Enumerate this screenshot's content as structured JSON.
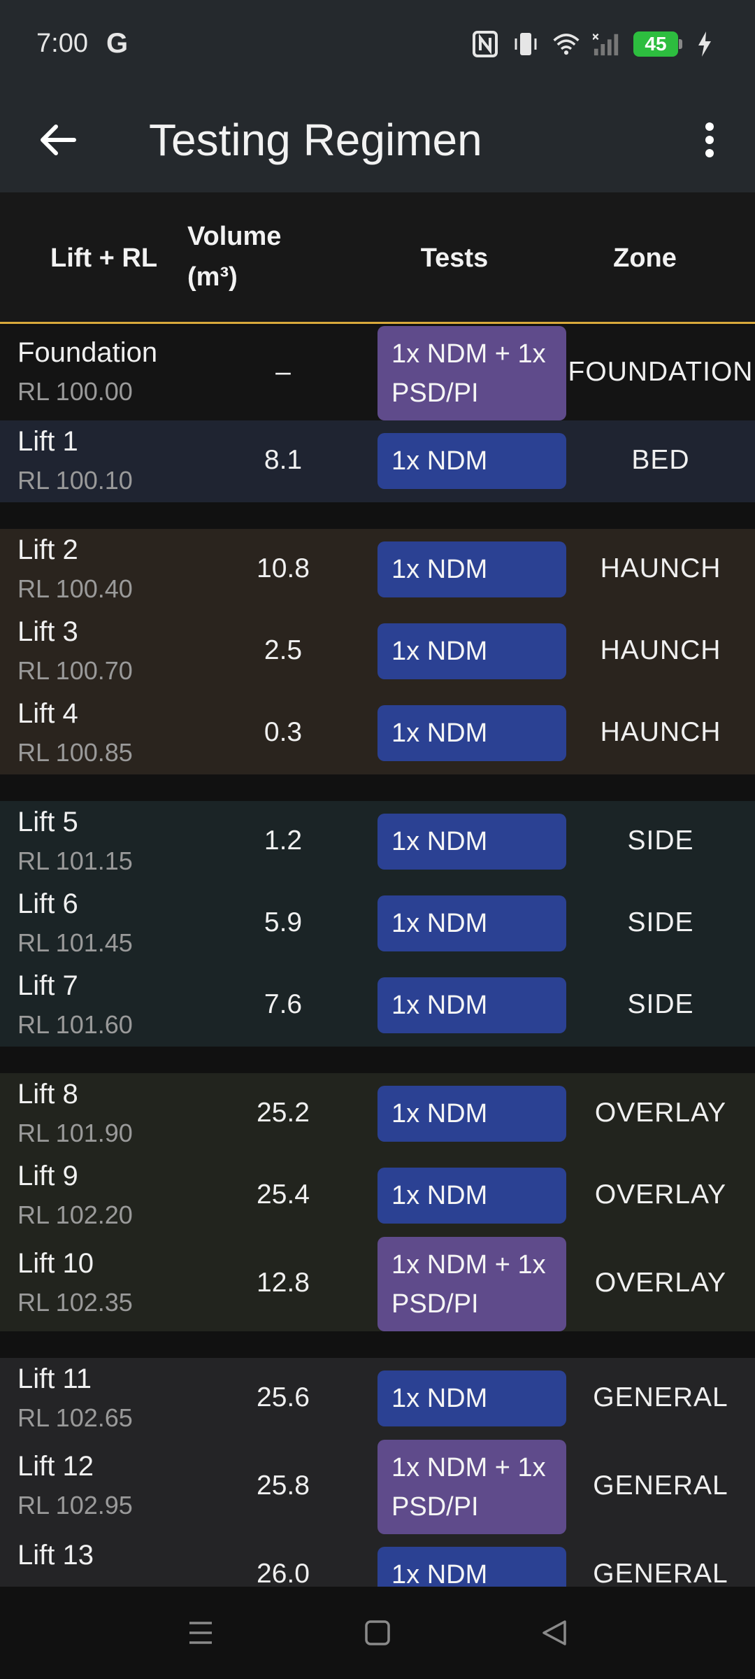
{
  "status_bar": {
    "time": "7:00",
    "g_label": "G",
    "battery": "45",
    "icons": [
      "nfc-icon",
      "vibrate-icon",
      "wifi-icon",
      "signal-icon",
      "charging-icon"
    ]
  },
  "app_bar": {
    "title": "Testing Regimen",
    "back_icon": "arrow-back-icon",
    "menu_icon": "more-vert-icon"
  },
  "table": {
    "headers": {
      "lift": "Lift + RL",
      "volume_line1": "Volume",
      "volume_line2": "(m³)",
      "tests": "Tests",
      "zone": "Zone"
    },
    "accent_color": "#d9a93b",
    "groups": [
      {
        "color": "#141414",
        "rows": [
          {
            "name": "Foundation",
            "rl": "RL 100.00",
            "volume": "–",
            "test": "1x NDM + 1x PSD/PI",
            "test_type": "psd",
            "zone": "FOUNDATION"
          }
        ]
      },
      {
        "color": "#1f2431",
        "rows": [
          {
            "name": "Lift 1",
            "rl": "RL 100.10",
            "volume": "8.1",
            "test": "1x NDM",
            "test_type": "ndm",
            "zone": "BED"
          }
        ]
      },
      {
        "color": "#2a241e",
        "rows": [
          {
            "name": "Lift 2",
            "rl": "RL 100.40",
            "volume": "10.8",
            "test": "1x NDM",
            "test_type": "ndm",
            "zone": "HAUNCH"
          },
          {
            "name": "Lift 3",
            "rl": "RL 100.70",
            "volume": "2.5",
            "test": "1x NDM",
            "test_type": "ndm",
            "zone": "HAUNCH"
          },
          {
            "name": "Lift 4",
            "rl": "RL 100.85",
            "volume": "0.3",
            "test": "1x NDM",
            "test_type": "ndm",
            "zone": "HAUNCH"
          }
        ]
      },
      {
        "color": "#1b2426",
        "rows": [
          {
            "name": "Lift 5",
            "rl": "RL 101.15",
            "volume": "1.2",
            "test": "1x NDM",
            "test_type": "ndm",
            "zone": "SIDE"
          },
          {
            "name": "Lift 6",
            "rl": "RL 101.45",
            "volume": "5.9",
            "test": "1x NDM",
            "test_type": "ndm",
            "zone": "SIDE"
          },
          {
            "name": "Lift 7",
            "rl": "RL 101.60",
            "volume": "7.6",
            "test": "1x NDM",
            "test_type": "ndm",
            "zone": "SIDE"
          }
        ]
      },
      {
        "color": "#22241e",
        "rows": [
          {
            "name": "Lift 8",
            "rl": "RL 101.90",
            "volume": "25.2",
            "test": "1x NDM",
            "test_type": "ndm",
            "zone": "OVERLAY"
          },
          {
            "name": "Lift 9",
            "rl": "RL 102.20",
            "volume": "25.4",
            "test": "1x NDM",
            "test_type": "ndm",
            "zone": "OVERLAY"
          },
          {
            "name": "Lift 10",
            "rl": "RL 102.35",
            "volume": "12.8",
            "test": "1x NDM + 1x PSD/PI",
            "test_type": "psd",
            "zone": "OVERLAY"
          }
        ]
      },
      {
        "color": "#242426",
        "rows": [
          {
            "name": "Lift 11",
            "rl": "RL 102.65",
            "volume": "25.6",
            "test": "1x NDM",
            "test_type": "ndm",
            "zone": "GENERAL"
          },
          {
            "name": "Lift 12",
            "rl": "RL 102.95",
            "volume": "25.8",
            "test": "1x NDM + 1x PSD/PI",
            "test_type": "psd",
            "zone": "GENERAL"
          },
          {
            "name": "Lift 13",
            "rl": "",
            "volume": "26.0",
            "test": "1x NDM",
            "test_type": "ndm",
            "zone": "GENERAL"
          }
        ]
      }
    ]
  },
  "nav_bar": {
    "icons": [
      "recents-icon",
      "home-icon",
      "back-nav-icon"
    ]
  }
}
